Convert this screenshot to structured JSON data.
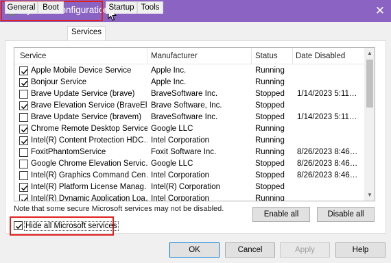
{
  "window": {
    "title": "System Configuration",
    "close_glyph": "✕"
  },
  "tabs": [
    {
      "label": "General"
    },
    {
      "label": "Boot"
    },
    {
      "label": "Services"
    },
    {
      "label": "Startup"
    },
    {
      "label": "Tools"
    }
  ],
  "table": {
    "headers": {
      "service": "Service",
      "manufacturer": "Manufacturer",
      "status": "Status",
      "date": "Date Disabled"
    },
    "rows": [
      {
        "checked": true,
        "service": "Apple Mobile Device Service",
        "manufacturer": "Apple Inc.",
        "status": "Running",
        "date": ""
      },
      {
        "checked": true,
        "service": "Bonjour Service",
        "manufacturer": "Apple Inc.",
        "status": "Running",
        "date": ""
      },
      {
        "checked": false,
        "service": "Brave Update Service (brave)",
        "manufacturer": "BraveSoftware Inc.",
        "status": "Stopped",
        "date": "1/14/2023 5:11…"
      },
      {
        "checked": true,
        "service": "Brave Elevation Service (BraveEl…",
        "manufacturer": "Brave Software, Inc.",
        "status": "Stopped",
        "date": ""
      },
      {
        "checked": false,
        "service": "Brave Update Service (bravem)",
        "manufacturer": "BraveSoftware Inc.",
        "status": "Stopped",
        "date": "1/14/2023 5:11…"
      },
      {
        "checked": true,
        "service": "Chrome Remote Desktop Service",
        "manufacturer": "Google LLC",
        "status": "Running",
        "date": ""
      },
      {
        "checked": true,
        "service": "Intel(R) Content Protection HDC…",
        "manufacturer": "Intel Corporation",
        "status": "Running",
        "date": ""
      },
      {
        "checked": false,
        "service": "FoxitPhantomService",
        "manufacturer": "Foxit Software Inc.",
        "status": "Running",
        "date": "8/26/2023 8:46…"
      },
      {
        "checked": false,
        "service": "Google Chrome Elevation Servic…",
        "manufacturer": "Google LLC",
        "status": "Stopped",
        "date": "8/26/2023 8:46…"
      },
      {
        "checked": false,
        "service": "Intel(R) Graphics Command Cen…",
        "manufacturer": "Intel Corporation",
        "status": "Stopped",
        "date": "8/26/2023 8:46…"
      },
      {
        "checked": true,
        "service": "Intel(R) Platform License Manag…",
        "manufacturer": "Intel(R) Corporation",
        "status": "Stopped",
        "date": ""
      },
      {
        "checked": true,
        "service": "Intel(R) Dynamic Application Loa…",
        "manufacturer": "Intel Corporation",
        "status": "Running",
        "date": ""
      }
    ]
  },
  "note": "Note that some secure Microsoft services may not be disabled.",
  "hide_ms": {
    "checked": true,
    "label": "Hide all Microsoft services"
  },
  "buttons": {
    "enable_all": "Enable all",
    "disable_all": "Disable all",
    "ok": "OK",
    "cancel": "Cancel",
    "apply": "Apply",
    "help": "Help"
  },
  "colors": {
    "titlebar": "#8b64c3",
    "highlight": "#e0201c"
  }
}
